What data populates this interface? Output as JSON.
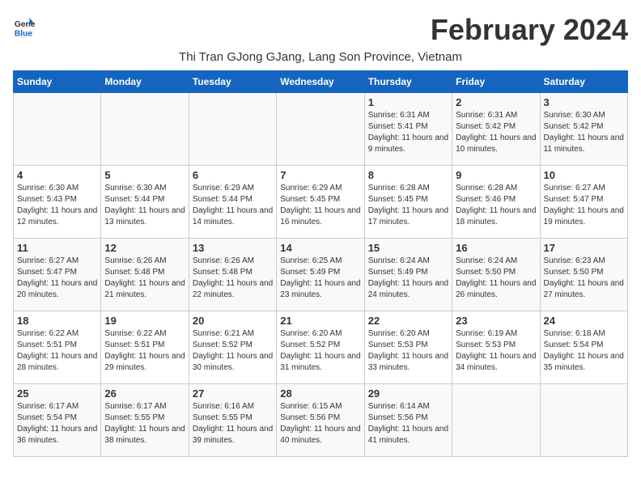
{
  "header": {
    "logo_line1": "General",
    "logo_line2": "Blue",
    "month": "February 2024",
    "subtitle": "Thi Tran GJong GJang, Lang Son Province, Vietnam"
  },
  "days_of_week": [
    "Sunday",
    "Monday",
    "Tuesday",
    "Wednesday",
    "Thursday",
    "Friday",
    "Saturday"
  ],
  "weeks": [
    [
      {
        "day": "",
        "sunrise": "",
        "sunset": "",
        "daylight": ""
      },
      {
        "day": "",
        "sunrise": "",
        "sunset": "",
        "daylight": ""
      },
      {
        "day": "",
        "sunrise": "",
        "sunset": "",
        "daylight": ""
      },
      {
        "day": "",
        "sunrise": "",
        "sunset": "",
        "daylight": ""
      },
      {
        "day": "1",
        "sunrise": "6:31 AM",
        "sunset": "5:41 PM",
        "daylight": "11 hours and 9 minutes."
      },
      {
        "day": "2",
        "sunrise": "6:31 AM",
        "sunset": "5:42 PM",
        "daylight": "11 hours and 10 minutes."
      },
      {
        "day": "3",
        "sunrise": "6:30 AM",
        "sunset": "5:42 PM",
        "daylight": "11 hours and 11 minutes."
      }
    ],
    [
      {
        "day": "4",
        "sunrise": "6:30 AM",
        "sunset": "5:43 PM",
        "daylight": "11 hours and 12 minutes."
      },
      {
        "day": "5",
        "sunrise": "6:30 AM",
        "sunset": "5:44 PM",
        "daylight": "11 hours and 13 minutes."
      },
      {
        "day": "6",
        "sunrise": "6:29 AM",
        "sunset": "5:44 PM",
        "daylight": "11 hours and 14 minutes."
      },
      {
        "day": "7",
        "sunrise": "6:29 AM",
        "sunset": "5:45 PM",
        "daylight": "11 hours and 16 minutes."
      },
      {
        "day": "8",
        "sunrise": "6:28 AM",
        "sunset": "5:45 PM",
        "daylight": "11 hours and 17 minutes."
      },
      {
        "day": "9",
        "sunrise": "6:28 AM",
        "sunset": "5:46 PM",
        "daylight": "11 hours and 18 minutes."
      },
      {
        "day": "10",
        "sunrise": "6:27 AM",
        "sunset": "5:47 PM",
        "daylight": "11 hours and 19 minutes."
      }
    ],
    [
      {
        "day": "11",
        "sunrise": "6:27 AM",
        "sunset": "5:47 PM",
        "daylight": "11 hours and 20 minutes."
      },
      {
        "day": "12",
        "sunrise": "6:26 AM",
        "sunset": "5:48 PM",
        "daylight": "11 hours and 21 minutes."
      },
      {
        "day": "13",
        "sunrise": "6:26 AM",
        "sunset": "5:48 PM",
        "daylight": "11 hours and 22 minutes."
      },
      {
        "day": "14",
        "sunrise": "6:25 AM",
        "sunset": "5:49 PM",
        "daylight": "11 hours and 23 minutes."
      },
      {
        "day": "15",
        "sunrise": "6:24 AM",
        "sunset": "5:49 PM",
        "daylight": "11 hours and 24 minutes."
      },
      {
        "day": "16",
        "sunrise": "6:24 AM",
        "sunset": "5:50 PM",
        "daylight": "11 hours and 26 minutes."
      },
      {
        "day": "17",
        "sunrise": "6:23 AM",
        "sunset": "5:50 PM",
        "daylight": "11 hours and 27 minutes."
      }
    ],
    [
      {
        "day": "18",
        "sunrise": "6:22 AM",
        "sunset": "5:51 PM",
        "daylight": "11 hours and 28 minutes."
      },
      {
        "day": "19",
        "sunrise": "6:22 AM",
        "sunset": "5:51 PM",
        "daylight": "11 hours and 29 minutes."
      },
      {
        "day": "20",
        "sunrise": "6:21 AM",
        "sunset": "5:52 PM",
        "daylight": "11 hours and 30 minutes."
      },
      {
        "day": "21",
        "sunrise": "6:20 AM",
        "sunset": "5:52 PM",
        "daylight": "11 hours and 31 minutes."
      },
      {
        "day": "22",
        "sunrise": "6:20 AM",
        "sunset": "5:53 PM",
        "daylight": "11 hours and 33 minutes."
      },
      {
        "day": "23",
        "sunrise": "6:19 AM",
        "sunset": "5:53 PM",
        "daylight": "11 hours and 34 minutes."
      },
      {
        "day": "24",
        "sunrise": "6:18 AM",
        "sunset": "5:54 PM",
        "daylight": "11 hours and 35 minutes."
      }
    ],
    [
      {
        "day": "25",
        "sunrise": "6:17 AM",
        "sunset": "5:54 PM",
        "daylight": "11 hours and 36 minutes."
      },
      {
        "day": "26",
        "sunrise": "6:17 AM",
        "sunset": "5:55 PM",
        "daylight": "11 hours and 38 minutes."
      },
      {
        "day": "27",
        "sunrise": "6:16 AM",
        "sunset": "5:55 PM",
        "daylight": "11 hours and 39 minutes."
      },
      {
        "day": "28",
        "sunrise": "6:15 AM",
        "sunset": "5:56 PM",
        "daylight": "11 hours and 40 minutes."
      },
      {
        "day": "29",
        "sunrise": "6:14 AM",
        "sunset": "5:56 PM",
        "daylight": "11 hours and 41 minutes."
      },
      {
        "day": "",
        "sunrise": "",
        "sunset": "",
        "daylight": ""
      },
      {
        "day": "",
        "sunrise": "",
        "sunset": "",
        "daylight": ""
      }
    ]
  ]
}
